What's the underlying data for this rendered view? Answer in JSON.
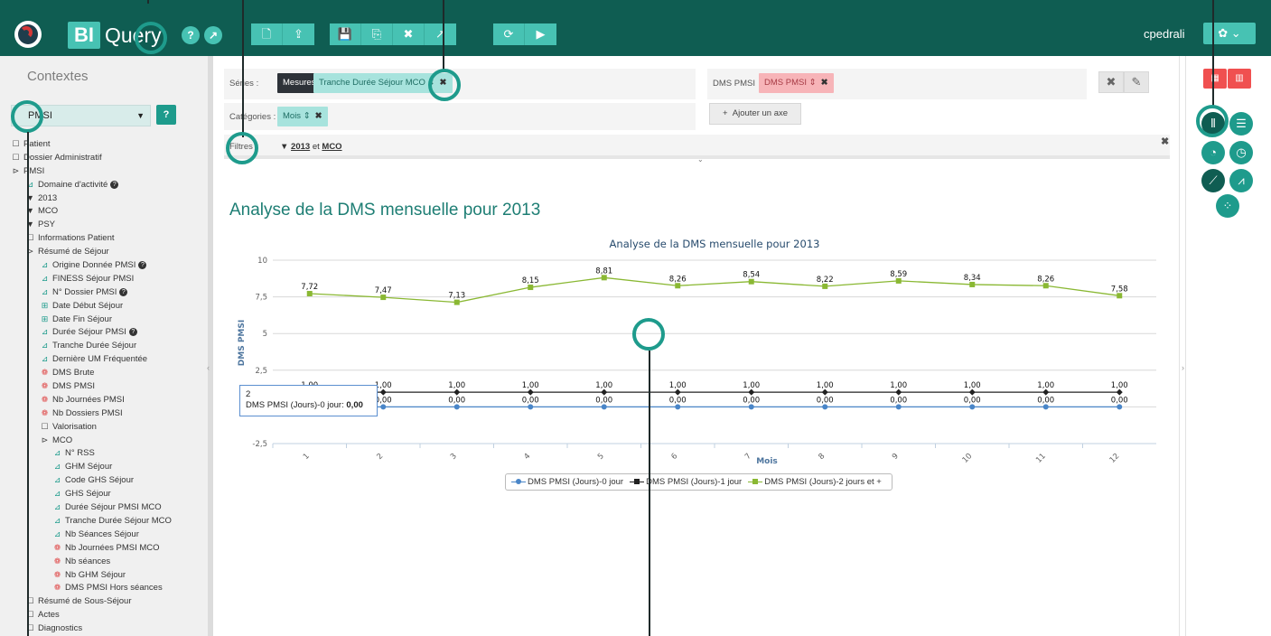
{
  "app": {
    "badge": "BI",
    "name": "Query",
    "user": "cpedrali",
    "help": "?",
    "expand": "↗",
    "settings": "✿ ⌄"
  },
  "toolbar": {
    "group1": [
      "🗋",
      "⇪"
    ],
    "group2": [
      "💾",
      "⎘",
      "✖",
      "↗"
    ],
    "group3": [
      "⟳",
      "▶"
    ]
  },
  "sidebar": {
    "title": "Contextes",
    "context_value": "PMSI",
    "help": "?",
    "tree": [
      {
        "level": 0,
        "icon": "folder",
        "label": "Patient"
      },
      {
        "level": 0,
        "icon": "folder",
        "label": "Dossier Administratif"
      },
      {
        "level": 0,
        "icon": "folder-open",
        "label": "PMSI"
      },
      {
        "level": 1,
        "icon": "dimension",
        "label": "Domaine d'activité",
        "help": true
      },
      {
        "level": 1,
        "icon": "filter",
        "label": "2013"
      },
      {
        "level": 1,
        "icon": "filter",
        "label": "MCO"
      },
      {
        "level": 1,
        "icon": "filter",
        "label": "PSY"
      },
      {
        "level": 1,
        "icon": "folder",
        "label": "Informations Patient"
      },
      {
        "level": 1,
        "icon": "folder-open",
        "label": "Résumé de Séjour"
      },
      {
        "level": 2,
        "icon": "dimension",
        "label": "Origine Donnée PMSI",
        "help": true
      },
      {
        "level": 2,
        "icon": "dimension",
        "label": "FINESS Séjour PMSI"
      },
      {
        "level": 2,
        "icon": "dimension",
        "label": "N° Dossier PMSI",
        "help": true
      },
      {
        "level": 2,
        "icon": "date",
        "label": "Date Début Séjour"
      },
      {
        "level": 2,
        "icon": "date",
        "label": "Date Fin Séjour"
      },
      {
        "level": 2,
        "icon": "dimension",
        "label": "Durée Séjour PMSI",
        "help": true
      },
      {
        "level": 2,
        "icon": "dimension",
        "label": "Tranche Durée Séjour"
      },
      {
        "level": 2,
        "icon": "dimension",
        "label": "Dernière UM Fréquentée"
      },
      {
        "level": 2,
        "icon": "measure",
        "label": "DMS Brute"
      },
      {
        "level": 2,
        "icon": "measure",
        "label": "DMS PMSI"
      },
      {
        "level": 2,
        "icon": "measure",
        "label": "Nb Journées PMSI"
      },
      {
        "level": 2,
        "icon": "measure",
        "label": "Nb Dossiers PMSI"
      },
      {
        "level": 2,
        "icon": "folder",
        "label": "Valorisation"
      },
      {
        "level": 2,
        "icon": "folder-open",
        "label": "MCO"
      },
      {
        "level": 3,
        "icon": "dimension",
        "label": "N° RSS"
      },
      {
        "level": 3,
        "icon": "dimension",
        "label": "GHM Séjour"
      },
      {
        "level": 3,
        "icon": "dimension",
        "label": "Code GHS Séjour"
      },
      {
        "level": 3,
        "icon": "dimension",
        "label": "GHS Séjour"
      },
      {
        "level": 3,
        "icon": "dimension",
        "label": "Durée Séjour PMSI MCO"
      },
      {
        "level": 3,
        "icon": "dimension",
        "label": "Tranche Durée Séjour MCO"
      },
      {
        "level": 3,
        "icon": "dimension",
        "label": "Nb Séances Séjour"
      },
      {
        "level": 3,
        "icon": "measure",
        "label": "Nb Journées PMSI MCO"
      },
      {
        "level": 3,
        "icon": "measure",
        "label": "Nb séances"
      },
      {
        "level": 3,
        "icon": "measure",
        "label": "Nb GHM Séjour"
      },
      {
        "level": 3,
        "icon": "measure",
        "label": "DMS PMSI Hors séances"
      },
      {
        "level": 1,
        "icon": "folder",
        "label": "Résumé de Sous-Séjour"
      },
      {
        "level": 1,
        "icon": "folder",
        "label": "Actes"
      },
      {
        "level": 1,
        "icon": "folder",
        "label": "Diagnostics"
      }
    ]
  },
  "config": {
    "series_label": "Séries :",
    "series_chip_dark": "Mesures",
    "series_chip": "Tranche Durée Séjour MCO",
    "categories_label": "Catégories :",
    "categories_chip": "Mois",
    "measure_label": "DMS PMSI",
    "measure_chip": "DMS PMSI",
    "add_axis": "Ajouter un axe",
    "add_axis_icon": "+",
    "filters_label": "Filtres :",
    "filter_a": "2013",
    "filter_join": "et",
    "filter_b": "MCO",
    "close": "✖",
    "edit": "✎"
  },
  "page_title": "Analyse de la DMS mensuelle pour 2013",
  "tooltip": {
    "line1": "2",
    "line2": "DMS PMSI (Jours)-0 jour: ",
    "value": "0,00"
  },
  "colors": {
    "topbar": "#0f5d52",
    "accent": "#47c2b3",
    "series0": "#4a86c8",
    "series1": "#222222",
    "series2": "#8ab833"
  },
  "chart_data": {
    "type": "line",
    "title": "Analyse de la DMS mensuelle pour 2013",
    "xlabel": "Mois",
    "ylabel": "DMS PMSI",
    "categories": [
      "1",
      "2",
      "3",
      "4",
      "5",
      "6",
      "7",
      "8",
      "9",
      "10",
      "11",
      "12"
    ],
    "ylim": [
      -2.5,
      10
    ],
    "yticks": [
      "-2,5",
      "0",
      "2,5",
      "5",
      "7,5",
      "10"
    ],
    "grid": true,
    "legend_position": "bottom",
    "series": [
      {
        "name": "DMS PMSI (Jours)-0 jour",
        "values": [
          0,
          0,
          0,
          0,
          0,
          0,
          0,
          0,
          0,
          0,
          0,
          0
        ],
        "labels": [
          "0,00",
          "0,00",
          "0,00",
          "0,00",
          "0,00",
          "0,00",
          "0,00",
          "0,00",
          "0,00",
          "0,00",
          "0,00",
          "0,00"
        ],
        "marker": "circle"
      },
      {
        "name": "DMS PMSI (Jours)-1 jour",
        "values": [
          1,
          1,
          1,
          1,
          1,
          1,
          1,
          1,
          1,
          1,
          1,
          1
        ],
        "labels": [
          "1,00",
          "1,00",
          "1,00",
          "1,00",
          "1,00",
          "1,00",
          "1,00",
          "1,00",
          "1,00",
          "1,00",
          "1,00",
          "1,00"
        ],
        "marker": "diamond"
      },
      {
        "name": "DMS PMSI (Jours)-2 jours et +",
        "values": [
          7.72,
          7.47,
          7.13,
          8.15,
          8.81,
          8.26,
          8.54,
          8.22,
          8.59,
          8.34,
          8.26,
          7.58
        ],
        "labels": [
          "7,72",
          "7,47",
          "7,13",
          "8,15",
          "8,81",
          "8,26",
          "8,54",
          "8,22",
          "8,59",
          "8,34",
          "8,26",
          "7,58"
        ],
        "marker": "square"
      }
    ]
  }
}
